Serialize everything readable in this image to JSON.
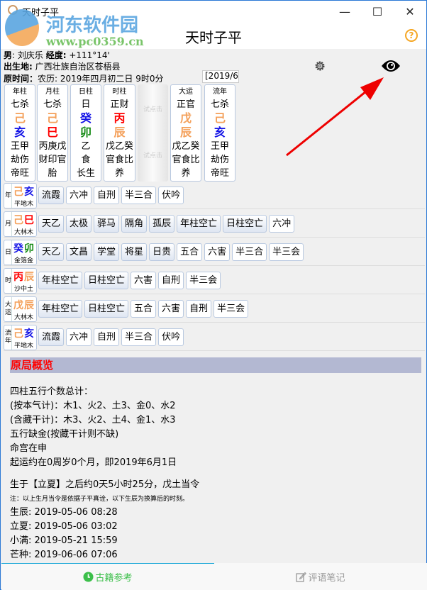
{
  "window": {
    "title": "天时子平",
    "minimize": "—",
    "maximize": "☐",
    "close": "✕"
  },
  "header": {
    "title": "天时子平",
    "help_icon": "help-circle-icon",
    "help_glyph": "?"
  },
  "watermark": {
    "line1": "河东软件园",
    "line2": "www.pc0359.cn"
  },
  "info": {
    "gender_label": "男",
    "name": ": 刘庆乐 ",
    "longitude_label": "经度:",
    "longitude": " +111°14'",
    "birthplace_label": "出生地:",
    "birthplace": " 广西壮族自治区苍梧县",
    "time_label": "原时间：",
    "time": "农历: 2019年四月初二日 9时0分",
    "date_box": "[2019/6"
  },
  "toolbar": {
    "settings_icon": "gear-icon",
    "view_icon": "eye-icon"
  },
  "colors": {
    "orange": "#f4a05a",
    "blue": "#1414e6",
    "red": "#ff0000",
    "green": "#118811",
    "accent": "#1aa7d8"
  },
  "pillars": [
    {
      "head": "年柱",
      "god": "七杀",
      "gan": "己",
      "ganColor": "orange",
      "zhi": "亥",
      "zhiColor": "blue",
      "hidden": "王甲",
      "hiddenGods": "劫伤",
      "stage": "帝旺"
    },
    {
      "head": "月柱",
      "god": "七杀",
      "gan": "己",
      "ganColor": "orange",
      "zhi": "巳",
      "zhiColor": "red",
      "hidden": "丙庚戊",
      "hiddenGods": "财印官",
      "stage": "胎"
    },
    {
      "head": "日柱",
      "god": "日",
      "gan": "癸",
      "ganColor": "blue",
      "zhi": "卯",
      "zhiColor": "green",
      "hidden": "乙",
      "hiddenGods": "食",
      "stage": "长生"
    },
    {
      "head": "时柱",
      "god": "正财",
      "gan": "丙",
      "ganColor": "red",
      "zhi": "辰",
      "zhiColor": "orange",
      "hidden": "戊乙癸",
      "hiddenGods": "官食比",
      "stage": "养"
    },
    {
      "head": "大运",
      "god": "正官",
      "gan": "戊",
      "ganColor": "orange",
      "zhi": "辰",
      "zhiColor": "orange",
      "hidden": "戊乙癸",
      "hiddenGods": "官食比",
      "stage": "养"
    },
    {
      "head": "流年",
      "god": "七杀",
      "gan": "己",
      "ganColor": "orange",
      "zhi": "亥",
      "zhiColor": "blue",
      "hidden": "王甲",
      "hiddenGods": "劫伤",
      "stage": "帝旺"
    }
  ],
  "tap_hint": {
    "top": "试点击",
    "bottom": "试点击"
  },
  "relations": [
    {
      "key": "年",
      "gan": "己",
      "ganColor": "orange",
      "zhi": "亥",
      "zhiColor": "blue",
      "nayin": "平地木",
      "shensha": [
        "流霞"
      ],
      "tags": [
        "六冲",
        "自刑",
        "半三合",
        "伏吟"
      ]
    },
    {
      "key": "月",
      "gan": "己",
      "ganColor": "orange",
      "zhi": "巳",
      "zhiColor": "red",
      "nayin": "大林木",
      "shensha": [
        "天乙",
        "太极",
        "驿马",
        "隔角",
        "孤辰",
        "年柱空亡",
        "日柱空亡"
      ],
      "tags": [
        "六冲"
      ]
    },
    {
      "key": "日",
      "gan": "癸",
      "ganColor": "blue",
      "zhi": "卯",
      "zhiColor": "green",
      "nayin": "金箔金",
      "shensha": [
        "天乙",
        "文昌",
        "学堂",
        "将星",
        "日贵"
      ],
      "tags": [
        "五合",
        "六害",
        "半三合",
        "半三会"
      ]
    },
    {
      "key": "时",
      "gan": "丙",
      "ganColor": "red",
      "zhi": "辰",
      "zhiColor": "orange",
      "nayin": "沙中土",
      "shensha": [
        "年柱空亡",
        "日柱空亡"
      ],
      "tags": [
        "六害",
        "自刑",
        "半三会"
      ]
    },
    {
      "key": "大运",
      "gan": "戊",
      "ganColor": "orange",
      "zhi": "辰",
      "zhiColor": "orange",
      "nayin": "大林木",
      "shensha": [
        "年柱空亡",
        "日柱空亡"
      ],
      "tags": [
        "五合",
        "六害",
        "自刑",
        "半三会"
      ]
    },
    {
      "key": "流年",
      "gan": "己",
      "ganColor": "orange",
      "zhi": "亥",
      "zhiColor": "blue",
      "nayin": "平地木",
      "shensha": [
        "流霞"
      ],
      "tags": [
        "六冲",
        "自刑",
        "半三合",
        "伏吟"
      ]
    }
  ],
  "overview": {
    "title": "原局概览",
    "lines": [
      "四柱五行个数总计：",
      "(按本气计)：木1、火2、土3、金0、水2",
      "(含藏干计)：木3、火2、土4、金1、水3",
      "五行缺金(按藏干计则不缺)",
      "命宫在申",
      "起运约在0周岁0个月，即2019年6月1日"
    ],
    "season": "生于【立夏】之后约0天5小时25分，戊土当令",
    "note": "注：以上生月当令是依据子平真诠，以下生辰为换算后的时刻。",
    "times": [
      "生辰: 2019-05-06 08:28",
      "立夏: 2019-05-06 03:02",
      "小满: 2019-05-21 15:59",
      "芒种: 2019-06-06 07:06"
    ]
  },
  "tabs": [
    {
      "label": "古籍参考",
      "icon": "clock-icon",
      "active": true
    },
    {
      "label": "评语笔记",
      "icon": "edit-note-icon",
      "active": false
    }
  ]
}
